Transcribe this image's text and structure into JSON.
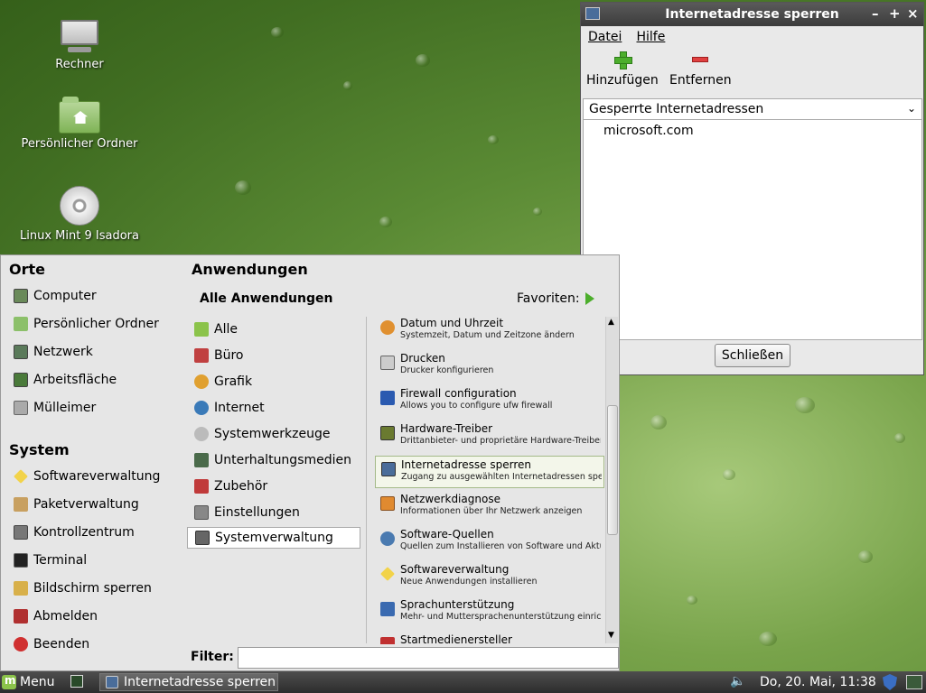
{
  "desktop": {
    "icons": [
      {
        "label": "Rechner",
        "icon": "computer-icon"
      },
      {
        "label": "Persönlicher Ordner",
        "icon": "home-folder-icon"
      },
      {
        "label": "Linux Mint 9 Isadora",
        "icon": "disc-icon"
      }
    ]
  },
  "window": {
    "title": "Internetadresse sperren",
    "controls": {
      "minimize": "–",
      "maximize": "+",
      "close": "×"
    },
    "menu": [
      "Datei",
      "Hilfe"
    ],
    "toolbar": {
      "add_label": "Hinzufügen",
      "remove_label": "Entfernen"
    },
    "combo_value": "Gesperrte Internetadressen",
    "blocked": [
      "microsoft.com"
    ],
    "close_label": "Schließen"
  },
  "menu": {
    "places_heading": "Orte",
    "places": [
      "Computer",
      "Persönlicher Ordner",
      "Netzwerk",
      "Arbeitsfläche",
      "Mülleimer"
    ],
    "system_heading": "System",
    "system": [
      "Softwareverwaltung",
      "Paketverwaltung",
      "Kontrollzentrum",
      "Terminal",
      "Bildschirm sperren",
      "Abmelden",
      "Beenden"
    ],
    "apps_heading": "Anwendungen",
    "all_apps": "Alle Anwendungen",
    "favorites": "Favoriten:",
    "categories": [
      "Alle",
      "Büro",
      "Grafik",
      "Internet",
      "Systemwerkzeuge",
      "Unterhaltungsmedien",
      "Zubehör",
      "Einstellungen",
      "Systemverwaltung"
    ],
    "selected_category": "Systemverwaltung",
    "apps": [
      {
        "name": "Datum und Uhrzeit",
        "desc": "Systemzeit, Datum und Zeitzone ändern"
      },
      {
        "name": "Drucken",
        "desc": "Drucker konfigurieren"
      },
      {
        "name": "Firewall configuration",
        "desc": "Allows you to configure ufw firewall"
      },
      {
        "name": "Hardware-Treiber",
        "desc": "Drittanbieter- und proprietäre Hardware-Treiber ko..."
      },
      {
        "name": "Internetadresse sperren",
        "desc": "Zugang zu ausgewählten Internetadressen sperren"
      },
      {
        "name": "Netzwerkdiagnose",
        "desc": "Informationen über Ihr Netzwerk anzeigen"
      },
      {
        "name": "Software-Quellen",
        "desc": "Quellen zum Installieren von Software und Aktualis..."
      },
      {
        "name": "Softwareverwaltung",
        "desc": "Neue Anwendungen installieren"
      },
      {
        "name": "Sprachunterstützung",
        "desc": "Mehr- und Muttersprachenunterstützung einrichten"
      },
      {
        "name": "Startmedienersteller",
        "desc": ""
      }
    ],
    "filter_label": "Filter:",
    "filter_value": ""
  },
  "taskbar": {
    "menu_label": "Menu",
    "task": "Internetadresse sperren",
    "clock": "Do, 20. Mai, 11:38"
  }
}
